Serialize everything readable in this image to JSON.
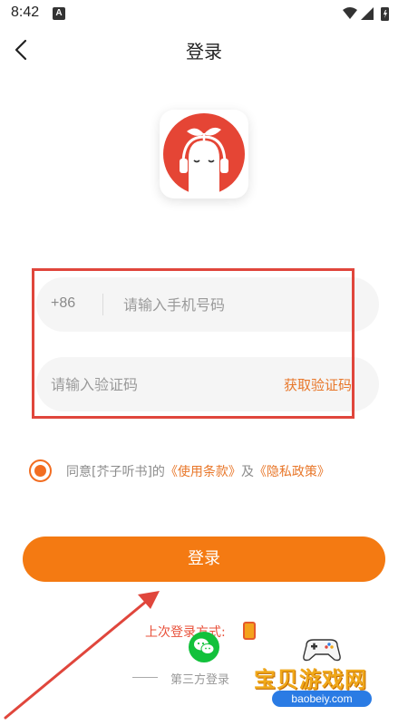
{
  "status_bar": {
    "time": "8:42",
    "notification_icon": "A",
    "icons": [
      "wifi-icon",
      "signal-icon",
      "battery-icon"
    ]
  },
  "header": {
    "title": "登录",
    "back_icon": "chevron-left-icon"
  },
  "form": {
    "country_code": "+86",
    "phone_placeholder": "请输入手机号码",
    "code_placeholder": "请输入验证码",
    "get_code_label": "获取验证码"
  },
  "agreement": {
    "checked": true,
    "prefix": "同意[芥子听书]的",
    "terms_link": "《使用条款》",
    "conjunction": "及",
    "privacy_link": "《隐私政策》"
  },
  "login_button": {
    "label": "登录"
  },
  "last_login": {
    "label": "上次登录方式:"
  },
  "third_party": {
    "label": "第三方登录"
  },
  "watermark": {
    "text": "宝贝游戏网",
    "url": "baobeiy.com"
  },
  "colors": {
    "accent": "#f47a12",
    "link": "#e8772a",
    "annotation": "#e0463c",
    "wechat": "#12c13b",
    "logo_red": "#e54535"
  }
}
